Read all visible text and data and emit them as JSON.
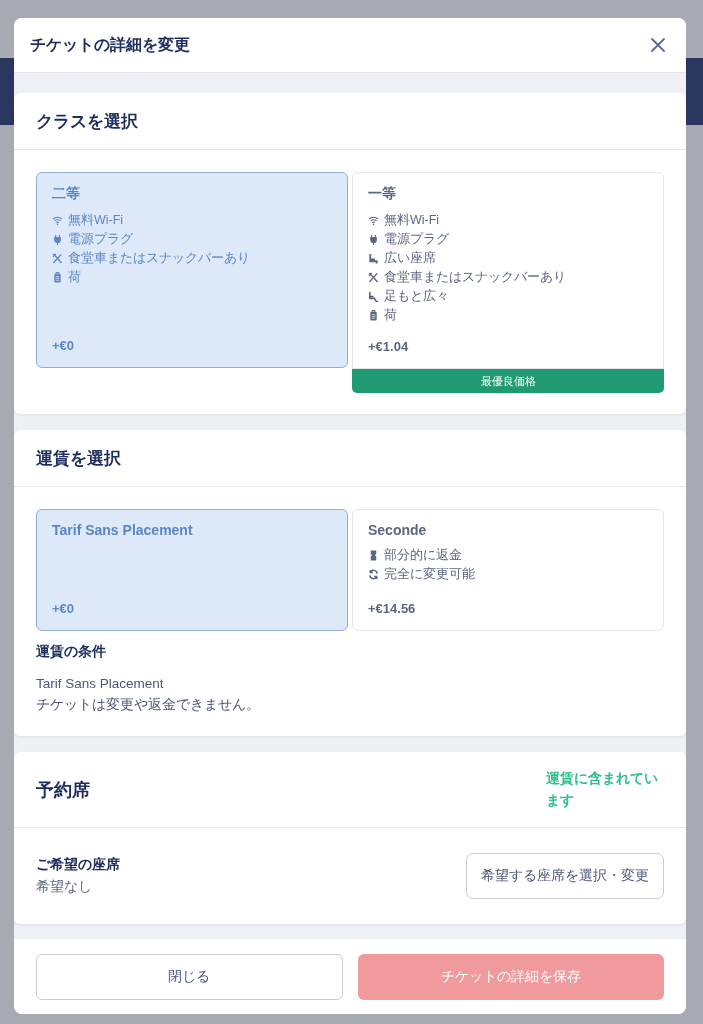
{
  "dialog": {
    "title": "チケットの詳細を変更"
  },
  "sections": [
    {
      "kind": "options",
      "title": "クラスを選択",
      "options": [
        {
          "name": "二等",
          "selected": true,
          "price": "+€0",
          "features": [
            {
              "kind": "wifi",
              "text": "無料Wi-Fi"
            },
            {
              "kind": "plug",
              "text": "電源プラグ"
            },
            {
              "kind": "dining",
              "text": "食堂車またはスナックバーあり"
            },
            {
              "kind": "luggage",
              "text": "荷"
            }
          ]
        },
        {
          "name": "一等",
          "selected": false,
          "price": "+€1.04",
          "badge": "最優良価格",
          "features": [
            {
              "kind": "wifi",
              "text": "無料Wi-Fi"
            },
            {
              "kind": "plug",
              "text": "電源プラグ"
            },
            {
              "kind": "seat",
              "text": "広い座席"
            },
            {
              "kind": "dining",
              "text": "食堂車またはスナックバーあり"
            },
            {
              "kind": "legroom",
              "text": "足もと広々"
            },
            {
              "kind": "luggage",
              "text": "荷"
            }
          ]
        }
      ]
    },
    {
      "kind": "options",
      "title": "運賃を選択",
      "options": [
        {
          "name": "Tarif Sans Placement",
          "selected": true,
          "price": "+€0"
        },
        {
          "name": "Seconde",
          "selected": false,
          "price": "+€14.56",
          "features": [
            {
              "kind": "refund",
              "text": "部分的に返金"
            },
            {
              "kind": "exchange",
              "text": "完全に変更可能"
            }
          ]
        }
      ],
      "conditions": {
        "title": "運賃の条件",
        "lines": [
          "Tarif Sans Placement",
          "チケットは変更や返金できません。"
        ]
      }
    },
    {
      "kind": "seat",
      "title": "予約席",
      "status": "運賃に含まれています",
      "label": "ご希望の座席",
      "value": "希望なし",
      "button": "希望する座席を選択・変更"
    }
  ],
  "footer": {
    "buttons": [
      {
        "label": "閉じる",
        "kind": "secondary",
        "disabled": false
      },
      {
        "label": "チケットの詳細を保存",
        "kind": "primary",
        "disabled": true
      }
    ]
  }
}
